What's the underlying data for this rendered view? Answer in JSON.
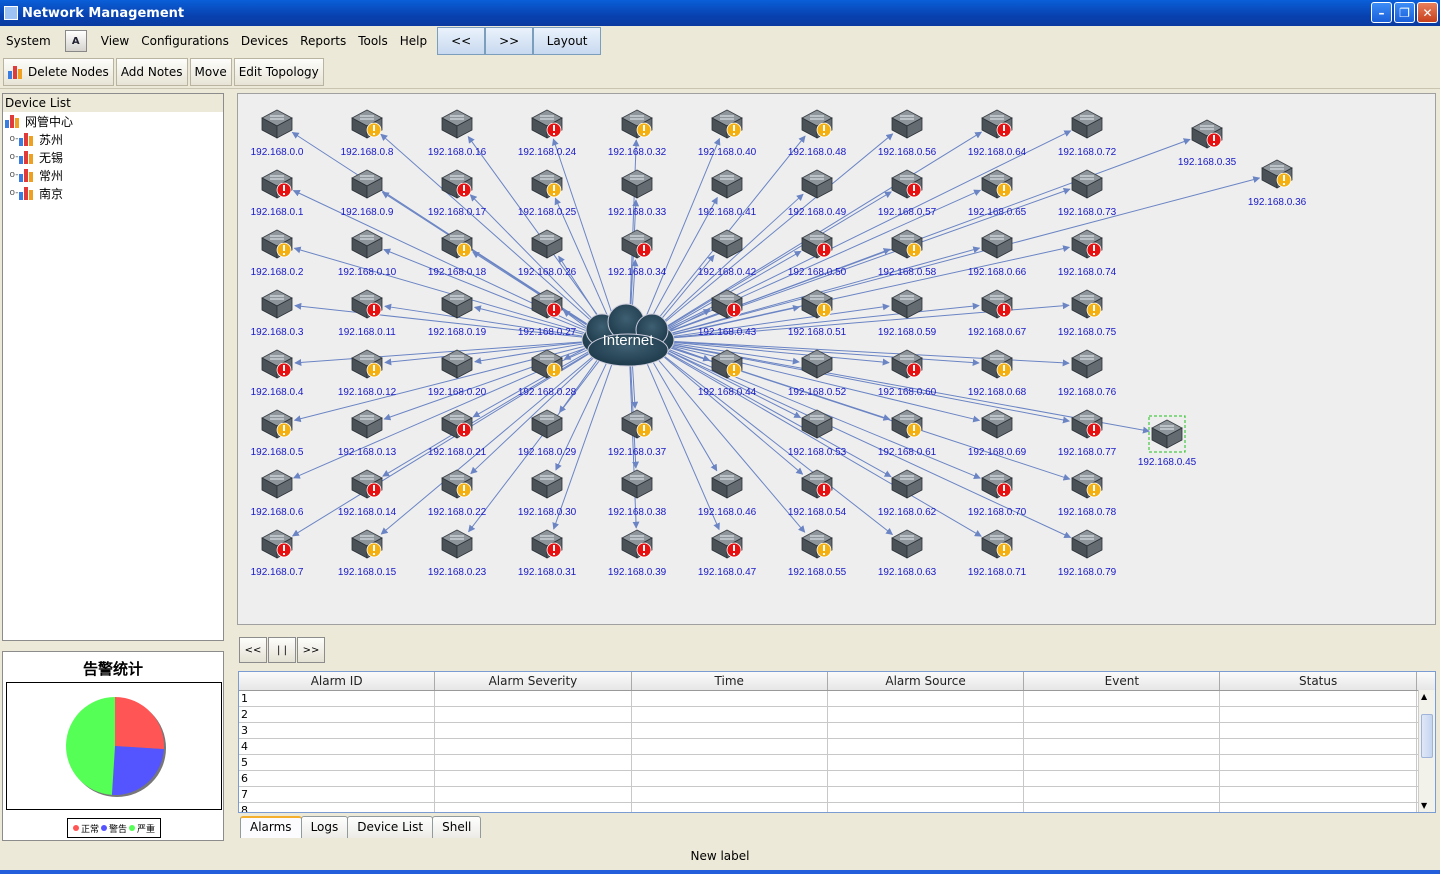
{
  "window": {
    "title": "Network Management"
  },
  "menu": {
    "items": [
      "System",
      "View",
      "Configurations",
      "Devices",
      "Reports",
      "Tools",
      "Help"
    ],
    "icon_letter": "A",
    "nav_prev": "<<",
    "nav_next": ">>",
    "layout": "Layout"
  },
  "toolbar": {
    "delete_nodes": "Delete Nodes",
    "add_notes": "Add Notes",
    "move": "Move",
    "edit_topology": "Edit Topology"
  },
  "device_list": {
    "header": "Device List",
    "root": "网管中心",
    "children": [
      "苏州",
      "无锡",
      "常州",
      "南京"
    ]
  },
  "alarm_stats": {
    "title": "告警统计",
    "slices": [
      {
        "label": "正常",
        "value": 26,
        "color": "#ff5555"
      },
      {
        "label": "警告",
        "value": 25,
        "color": "#5555ff"
      },
      {
        "label": "严重",
        "value": 49,
        "color": "#55ff55"
      }
    ]
  },
  "topology": {
    "center_label": "Internet",
    "node_status_order": [
      "ok",
      "crit",
      "warn",
      "ok",
      "crit",
      "warn",
      "ok",
      "crit",
      "warn",
      "ok"
    ],
    "grid_columns": [
      [
        "192.168.0.0",
        "192.168.0.1",
        "192.168.0.2",
        "192.168.0.3",
        "192.168.0.4",
        "192.168.0.5",
        "192.168.0.6",
        "192.168.0.7"
      ],
      [
        "192.168.0.8",
        "192.168.0.9",
        "192.168.0.10",
        "192.168.0.11",
        "192.168.0.12",
        "192.168.0.13",
        "192.168.0.14",
        "192.168.0.15"
      ],
      [
        "192.168.0.16",
        "192.168.0.17",
        "192.168.0.18",
        "192.168.0.19",
        "192.168.0.20",
        "192.168.0.21",
        "192.168.0.22",
        "192.168.0.23"
      ],
      [
        "192.168.0.24",
        "192.168.0.25",
        "192.168.0.26",
        "192.168.0.27",
        "192.168.0.28",
        "192.168.0.29",
        "192.168.0.30",
        "192.168.0.31"
      ],
      [
        "192.168.0.32",
        "192.168.0.33",
        "192.168.0.34",
        "",
        "",
        "192.168.0.37",
        "192.168.0.38",
        "192.168.0.39"
      ],
      [
        "192.168.0.40",
        "192.168.0.41",
        "192.168.0.42",
        "192.168.0.43",
        "192.168.0.44",
        "",
        "192.168.0.46",
        "192.168.0.47"
      ],
      [
        "192.168.0.48",
        "192.168.0.49",
        "192.168.0.50",
        "192.168.0.51",
        "192.168.0.52",
        "192.168.0.53",
        "192.168.0.54",
        "192.168.0.55"
      ],
      [
        "192.168.0.56",
        "192.168.0.57",
        "192.168.0.58",
        "192.168.0.59",
        "192.168.0.60",
        "192.168.0.61",
        "192.168.0.62",
        "192.168.0.63"
      ],
      [
        "192.168.0.64",
        "192.168.0.65",
        "192.168.0.66",
        "192.168.0.67",
        "192.168.0.68",
        "192.168.0.69",
        "192.168.0.70",
        "192.168.0.71"
      ],
      [
        "192.168.0.72",
        "192.168.0.73",
        "192.168.0.74",
        "192.168.0.75",
        "192.168.0.76",
        "192.168.0.77",
        "192.168.0.78",
        "192.168.0.79"
      ]
    ],
    "extra_nodes": [
      "192.168.0.35",
      "192.168.0.36",
      "192.168.0.45"
    ],
    "status_colors": {
      "crit": "#e81010",
      "warn": "#f4b010"
    }
  },
  "player": {
    "prev": "<<",
    "pause": "| |",
    "next": ">>"
  },
  "alarms_table": {
    "columns": [
      "Alarm ID",
      "Alarm Severity",
      "Time",
      "Alarm Source",
      "Event",
      "Status"
    ],
    "rows": [
      "1",
      "2",
      "3",
      "4",
      "5",
      "6",
      "7",
      "8"
    ]
  },
  "tabs": [
    "Alarms",
    "Logs",
    "Device List",
    "Shell"
  ],
  "status_label": "New label"
}
